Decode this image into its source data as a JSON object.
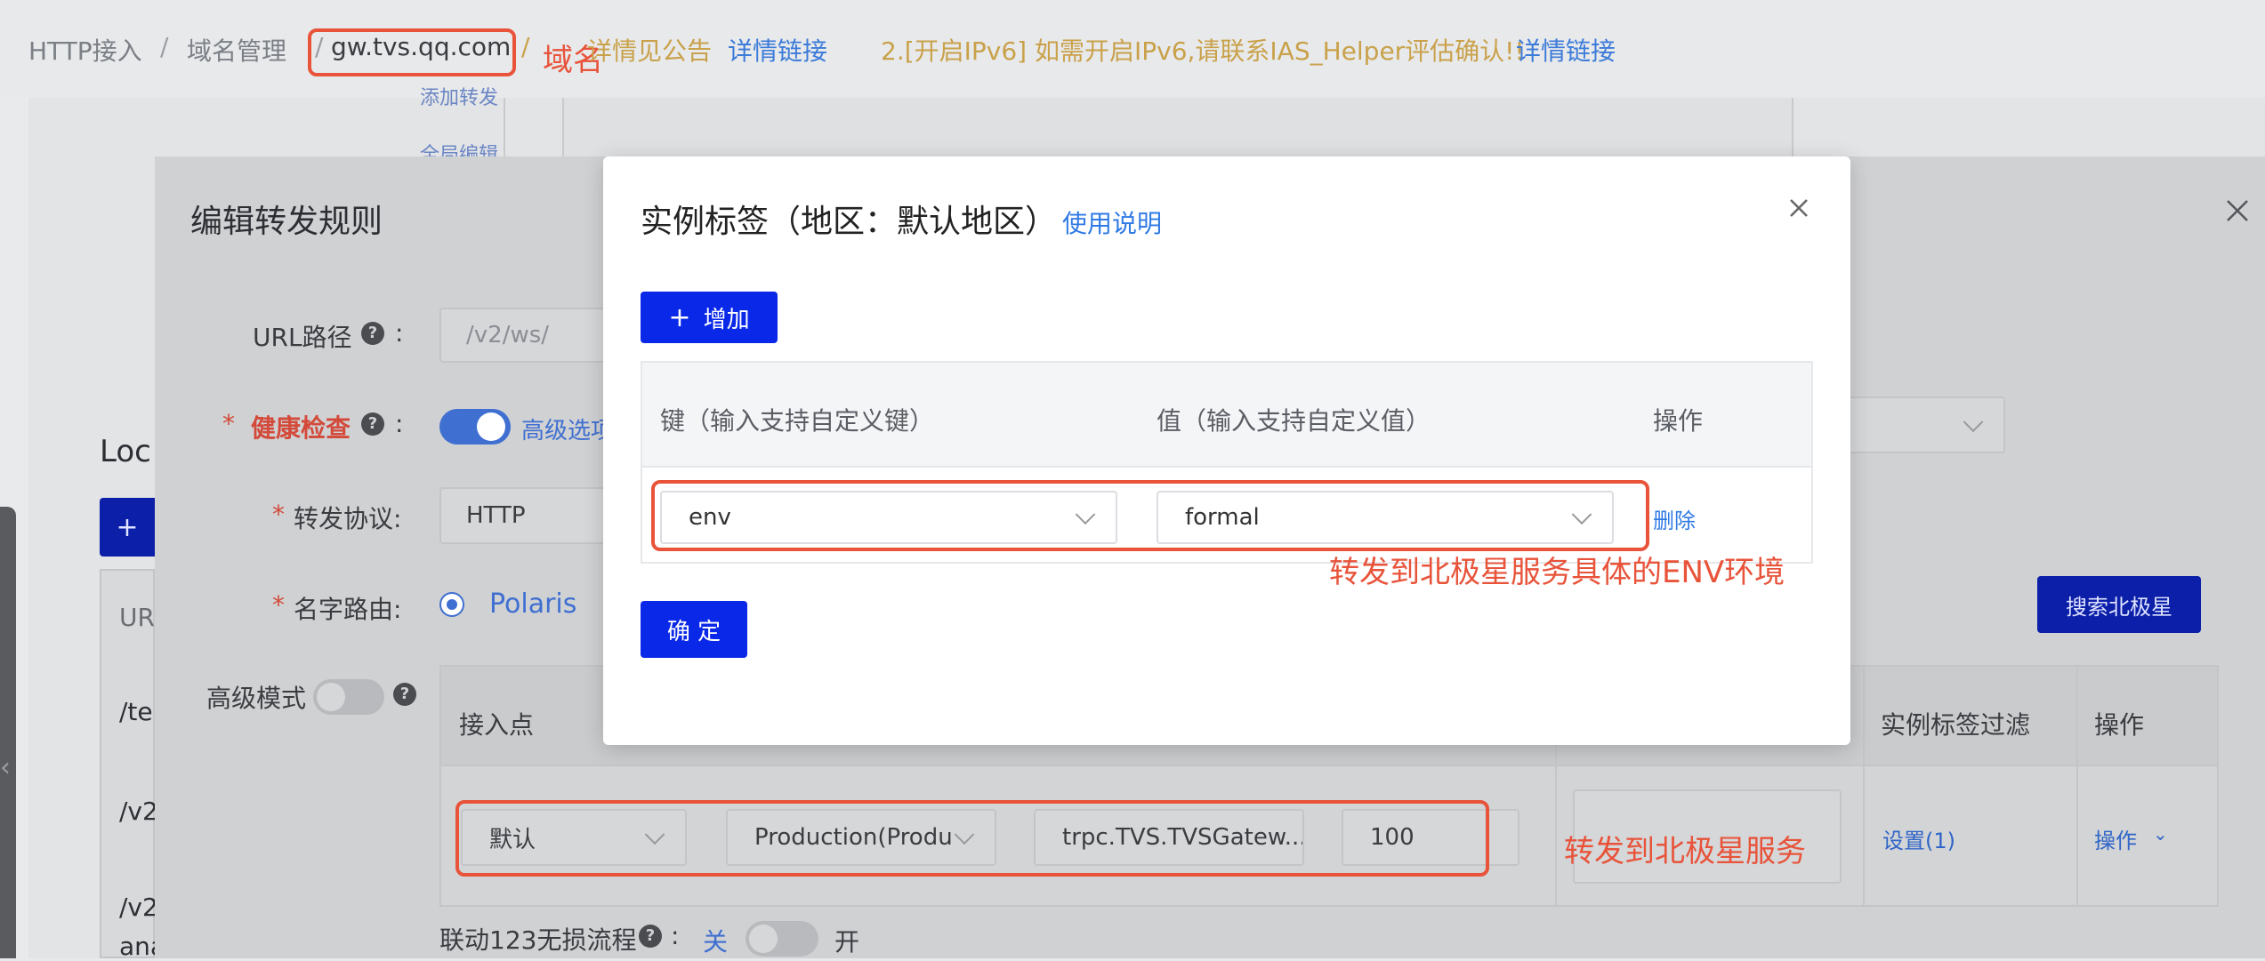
{
  "breadcrumb": {
    "item1": "HTTP接入",
    "sep": "/",
    "item2": "域名管理",
    "item3": "gw.tvs.qq.com"
  },
  "notices": {
    "notice1_text": "详情见公告",
    "notice1_link": "详情链接",
    "notice2_text": "2.[开启IPv6] 如需开启IPv6,请联系IAS_Helper评估确认!!",
    "notice2_link": "详情链接"
  },
  "annotations": {
    "domain_label": "域名",
    "env_label": "转发到北极星服务具体的ENV环境",
    "polaris_label": "转发到北极星服务"
  },
  "background": {
    "side_link1": "添加转发",
    "side_link2": "全局编辑",
    "loc_title": "Loc",
    "plus": "+",
    "left_rows": [
      "UR",
      "/te",
      "/v2",
      "/v2",
      "ana"
    ]
  },
  "drawer": {
    "title": "编辑转发规则",
    "url_label": "URL路径",
    "url_placeholder": "/v2/ws/",
    "health_label": "健康检查",
    "health_adv": "高级选项",
    "protocol_label": "转发协议:",
    "protocol_value": "HTTP",
    "name_route_label": "名字路由:",
    "name_route_value": "Polaris",
    "adv_mode_label": "高级模式",
    "search_button": "搜索北极星",
    "table_headers": {
      "access_point": "接入点",
      "instance_filter": "实例标签过滤",
      "ops": "操作"
    },
    "row": {
      "access_point": "默认",
      "env": "Production(Produ",
      "service": "trpc.TVS.TVSGatew...",
      "weight": "100",
      "filter_link": "设置(1)",
      "ops_link": "操作"
    },
    "lossless_label": "联动123无损流程",
    "lossless_off": "关",
    "lossless_on": "开",
    "colon": ":"
  },
  "modal": {
    "title": "实例标签（地区：默认地区）",
    "help_link": "使用说明",
    "add_button": "增加",
    "col_key": "键（输入支持自定义键）",
    "col_value": "值（输入支持自定义值）",
    "col_ops": "操作",
    "row_key": "env",
    "row_value": "formal",
    "row_delete": "删除",
    "confirm_button": "确 定"
  },
  "colors": {
    "primary": "#0a28e8",
    "link": "#2f7ae5",
    "annotation": "#e8533a"
  }
}
